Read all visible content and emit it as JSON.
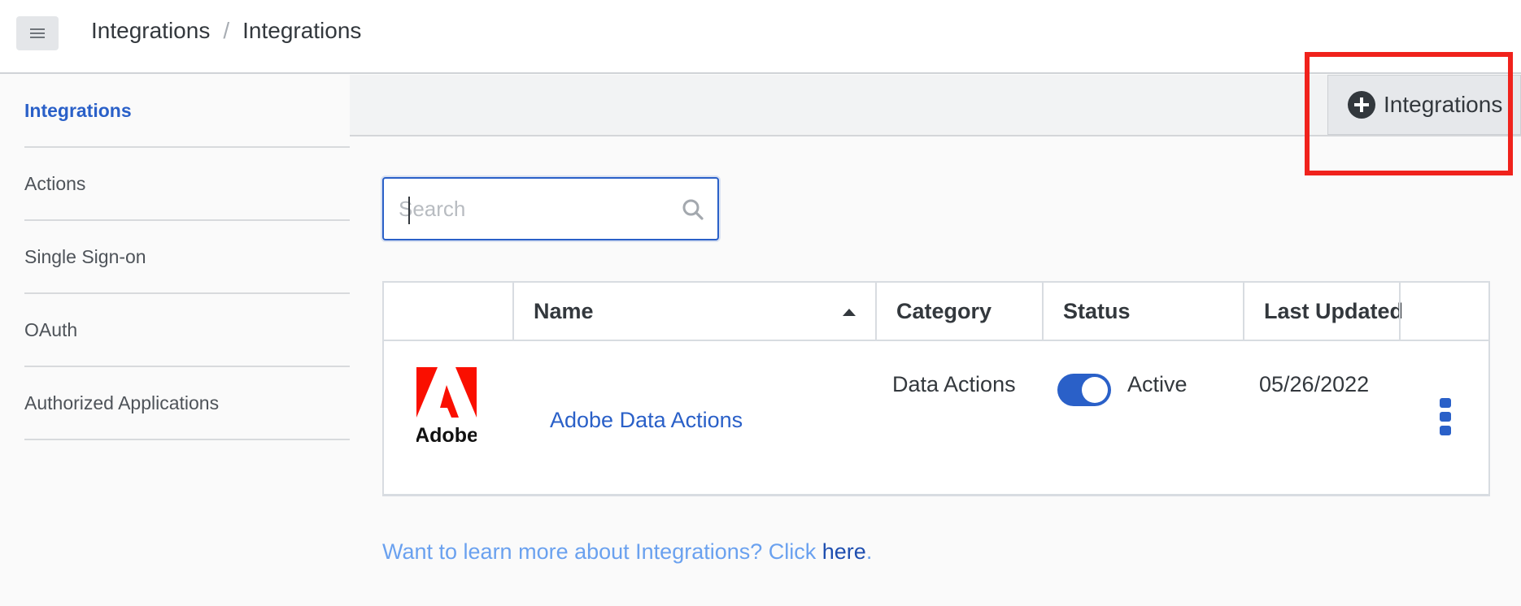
{
  "breadcrumb": {
    "root": "Integrations",
    "separator": "/",
    "current": "Integrations"
  },
  "sidebar": {
    "items": [
      {
        "label": "Integrations",
        "active": true
      },
      {
        "label": "Actions"
      },
      {
        "label": "Single Sign-on"
      },
      {
        "label": "OAuth"
      },
      {
        "label": "Authorized Applications"
      }
    ]
  },
  "toolbar": {
    "add_label": "Integrations",
    "add_icon": "plus-circle-icon"
  },
  "search": {
    "placeholder": "Search",
    "value": ""
  },
  "table": {
    "columns": [
      "",
      "Name",
      "Category",
      "Status",
      "Last Updated",
      ""
    ],
    "sort": {
      "column": "Name",
      "direction": "ascending"
    },
    "rows": [
      {
        "logo_text": "Adobe",
        "name": "Adobe Data Actions",
        "category": "Data Actions",
        "status": "Active",
        "status_on": true,
        "last_updated": "05/26/2022"
      }
    ]
  },
  "footer": {
    "text": "Want to learn more about Integrations? Click ",
    "link": "here",
    "suffix": "."
  },
  "colors": {
    "accent": "#2a60c8",
    "highlight": "#f0221c",
    "adobe_red": "#fa0f00"
  }
}
